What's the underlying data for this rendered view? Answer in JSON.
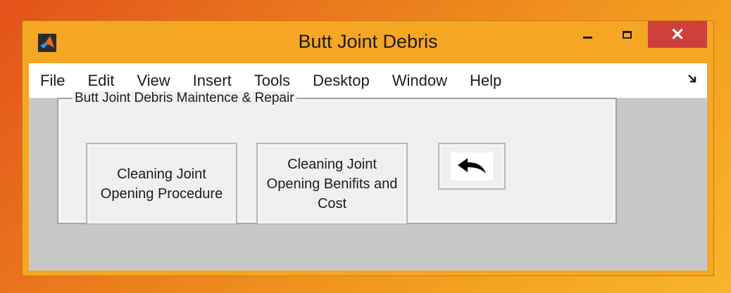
{
  "window": {
    "title": "Butt Joint Debris",
    "close_label": "✕",
    "icons": {
      "app": "matlab-icon",
      "minimize": "minimize-icon",
      "maximize": "maximize-icon",
      "close": "close-icon"
    }
  },
  "menubar": {
    "items": [
      {
        "label": "File"
      },
      {
        "label": "Edit"
      },
      {
        "label": "View"
      },
      {
        "label": "Insert"
      },
      {
        "label": "Tools"
      },
      {
        "label": "Desktop"
      },
      {
        "label": "Window"
      },
      {
        "label": "Help"
      }
    ],
    "dock_icon": "dock-arrow-icon"
  },
  "panel": {
    "title": "Butt Joint Debris Maintence & Repair",
    "buttons": {
      "procedure": "Cleaning Joint\nOpening Procedure",
      "benefits": "Cleaning Joint\nOpening Benifits and\nCost",
      "back_icon": "back-arrow-icon"
    }
  },
  "colors": {
    "desktop_orange": "#ea7a1c",
    "window_frame": "#f5a623",
    "close_red": "#cf3f3b",
    "client_gray": "#c8c8c8",
    "panel_bg": "#f0f0f0"
  }
}
